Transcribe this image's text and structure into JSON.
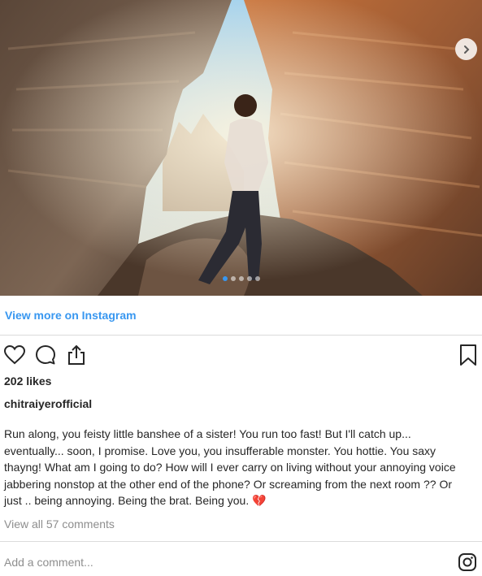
{
  "post": {
    "view_more_label": "View more on Instagram",
    "likes": "202 likes",
    "username": "chitraiyerofficial",
    "caption": "Run along, you feisty little banshee of a sister! You run too fast! But I'll catch up... eventually... soon, I promise. Love you, you insufferable monster. You hottie. You saxy thayng! What am I going to do? How will I ever carry on living without your annoying voice jabbering nonstop at the other end of the phone? Or screaming from the next room ?? Or just .. being annoying. Being the brat. Being you. 💔",
    "view_comments": "View all 57 comments",
    "add_comment_placeholder": "Add a comment...",
    "carousel_count": 5,
    "carousel_active_index": 0
  },
  "icons": {
    "like": "heart-icon",
    "comment": "comment-icon",
    "share": "share-icon",
    "save": "bookmark-icon",
    "next": "chevron-right-icon",
    "brand": "instagram-icon"
  },
  "colors": {
    "link": "#3897f0",
    "text": "#262626",
    "muted": "#8e8e8e",
    "divider": "#dbdbdb"
  }
}
